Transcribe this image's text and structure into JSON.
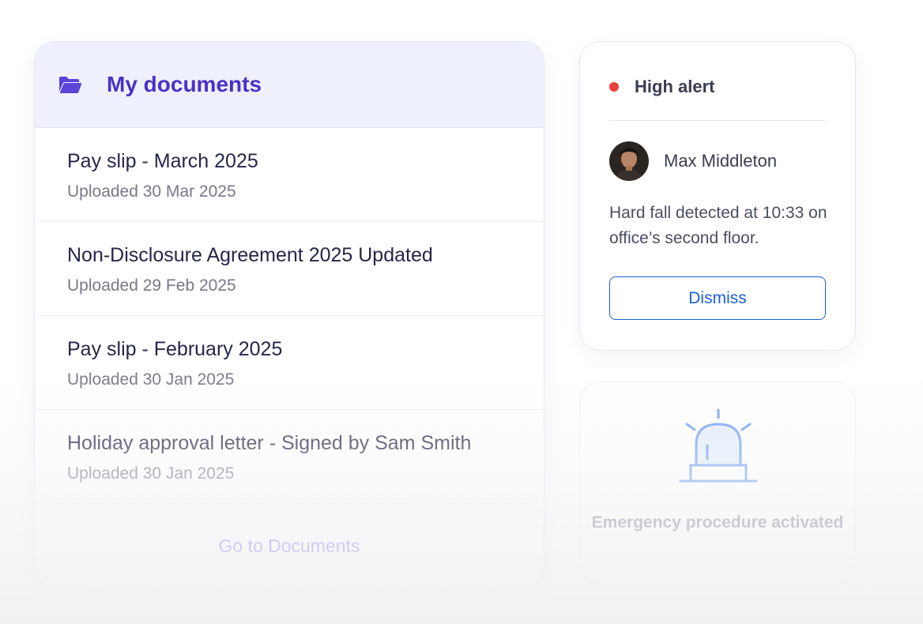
{
  "documents": {
    "title": "My documents",
    "items": [
      {
        "name": "Pay slip - March 2025",
        "date": "Uploaded 30 Mar 2025"
      },
      {
        "name": "Non-Disclosure Agreement 2025 Updated",
        "date": "Uploaded 29 Feb 2025"
      },
      {
        "name": "Pay slip - February 2025",
        "date": "Uploaded 30 Jan 2025"
      },
      {
        "name": "Holiday approval letter - Signed by Sam Smith",
        "date": "Uploaded 30 Jan 2025"
      }
    ],
    "link_label": "Go to Documents",
    "icon": "folder-open-icon"
  },
  "alert": {
    "status": "High alert",
    "status_color": "#e8403d",
    "person_name": "Max Middleton",
    "message": "Hard fall detected at 10:33 on office’s second floor.",
    "dismiss_label": "Dismiss"
  },
  "emergency": {
    "label": "Emergency procedure activated",
    "icon": "siren-icon"
  },
  "colors": {
    "accent": "#4b31c7",
    "header_bg": "#eef0fd",
    "button": "#1d5fd6",
    "siren": "#6f9ef0"
  }
}
